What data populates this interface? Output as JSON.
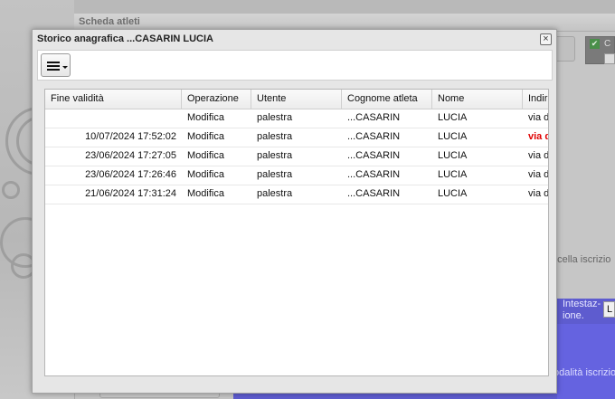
{
  "background": {
    "window_title": "Scheda atleti",
    "checkbox_label": "C",
    "cancel_label": "ncella iscrizio",
    "intestazione_label": "Intestaz-\nione.",
    "intestazione_value": "L",
    "modalita_label": "odalità iscrizio"
  },
  "dialog": {
    "title": "Storico anagrafica ...CASARIN LUCIA",
    "close_glyph": "×",
    "menu_icon": "hamburger-menu-icon"
  },
  "table": {
    "columns": [
      "Fine validità",
      "Operazione",
      "Utente",
      "Cognome atleta",
      "Nome",
      "Indiri"
    ],
    "rows": [
      {
        "fine_validita": "",
        "operazione": "Modifica",
        "utente": "palestra",
        "cognome": "...CASARIN",
        "nome": "LUCIA",
        "indirizzo": "via d",
        "indirizzo_changed": false
      },
      {
        "fine_validita": "10/07/2024 17:52:02",
        "operazione": "Modifica",
        "utente": "palestra",
        "cognome": "...CASARIN",
        "nome": "LUCIA",
        "indirizzo": "via d",
        "indirizzo_changed": true
      },
      {
        "fine_validita": "23/06/2024 17:27:05",
        "operazione": "Modifica",
        "utente": "palestra",
        "cognome": "...CASARIN",
        "nome": "LUCIA",
        "indirizzo": "via d",
        "indirizzo_changed": false
      },
      {
        "fine_validita": "23/06/2024 17:26:46",
        "operazione": "Modifica",
        "utente": "palestra",
        "cognome": "...CASARIN",
        "nome": "LUCIA",
        "indirizzo": "via d",
        "indirizzo_changed": false
      },
      {
        "fine_validita": "21/06/2024 17:31:24",
        "operazione": "Modifica",
        "utente": "palestra",
        "cognome": "...CASARIN",
        "nome": "LUCIA",
        "indirizzo": "via d",
        "indirizzo_changed": false
      }
    ]
  },
  "colors": {
    "changed_text": "#e00000",
    "background_accent": "#5e5ccf"
  }
}
